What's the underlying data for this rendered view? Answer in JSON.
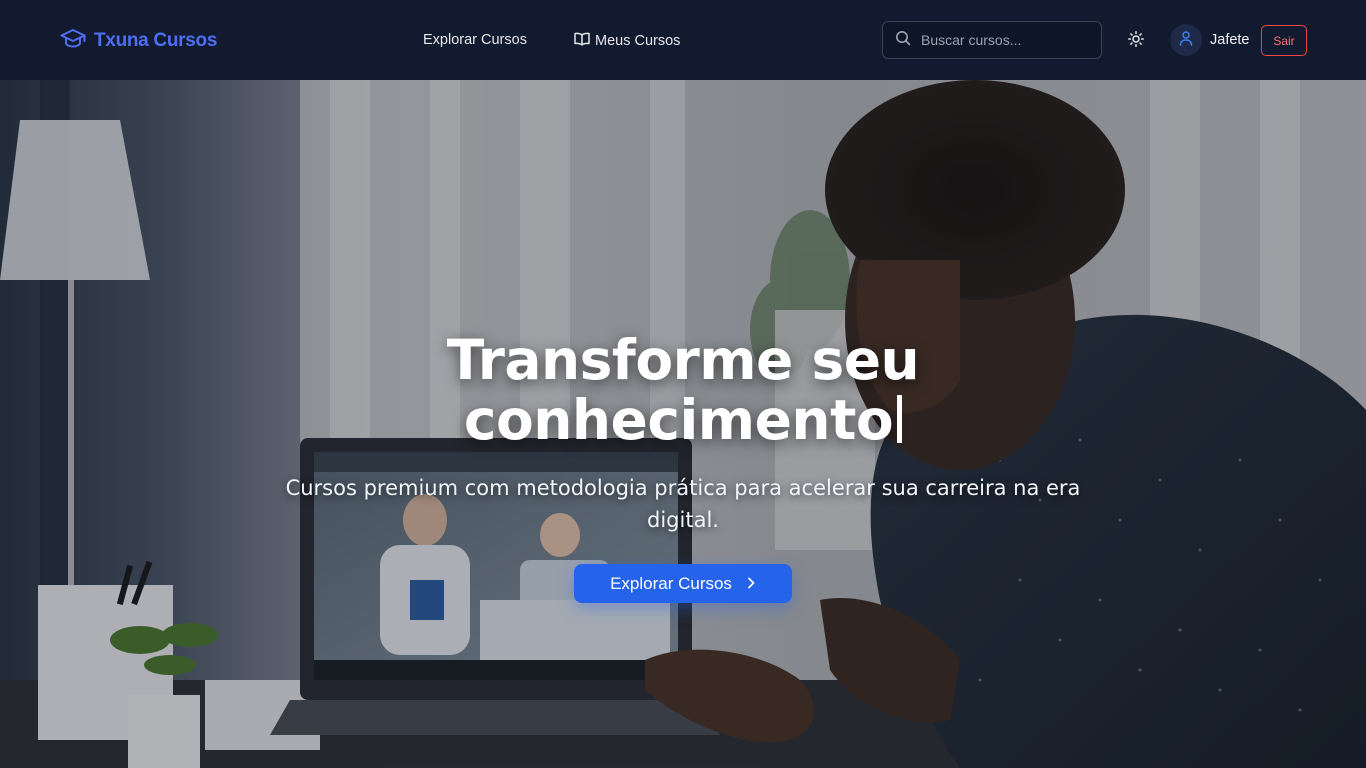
{
  "brand": {
    "name": "Txuna Cursos",
    "icon": "graduation-cap-icon",
    "color": "#4f6ef5"
  },
  "nav": {
    "explore_label": "Explorar Cursos",
    "my_courses_label": "Meus Cursos",
    "my_courses_icon": "book-open-icon"
  },
  "search": {
    "placeholder": "Buscar cursos...",
    "value": ""
  },
  "theme_toggle": {
    "icon": "sun-icon"
  },
  "user": {
    "name": "Jafete",
    "icon": "user-icon"
  },
  "logout": {
    "label": "Sair",
    "color": "#ef4444"
  },
  "hero": {
    "title_line1": "Transforme seu",
    "title_line2": "conhecimento",
    "subtitle": "Cursos premium com metodologia prática para acelerar sua carreira na era digital.",
    "cta_label": "Explorar Cursos",
    "cta_icon": "chevron-right-icon",
    "cta_color": "#2563eb"
  },
  "colors": {
    "navbar_bg": "#111a2e",
    "accent": "#2563eb"
  }
}
